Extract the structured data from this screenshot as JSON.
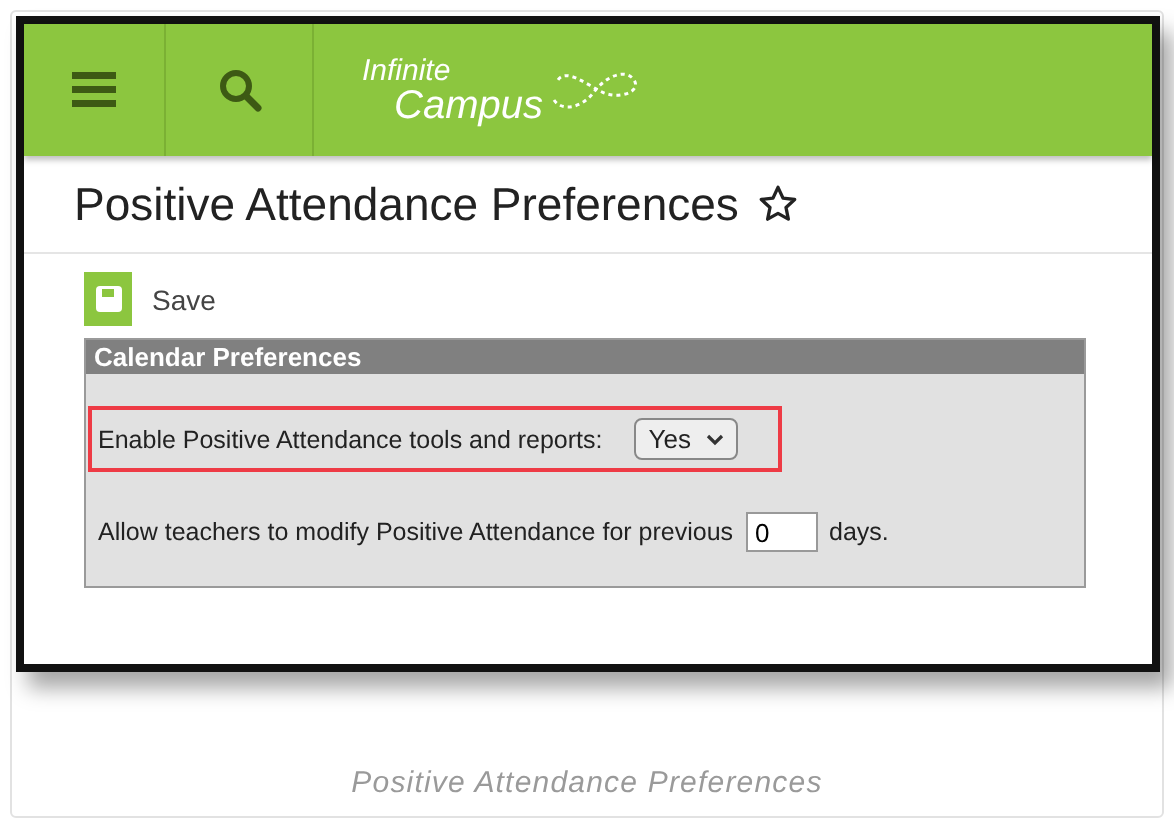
{
  "header": {
    "logo": {
      "line_1": "Infinite",
      "line_2": "Campus"
    }
  },
  "page": {
    "title": "Positive Attendance Preferences",
    "save_button": "Save"
  },
  "section": {
    "title": "Calendar Preferences",
    "fields": [
      {
        "kind": "select",
        "label": "Enable Positive Attendance tools and reports:",
        "value": "Yes",
        "highlighted": true
      },
      {
        "kind": "number",
        "label": "Allow teachers to modify Positive Attendance for previous",
        "value": "0",
        "suffix": "days.",
        "highlighted": false
      }
    ]
  },
  "caption": "Positive Attendance Preferences"
}
